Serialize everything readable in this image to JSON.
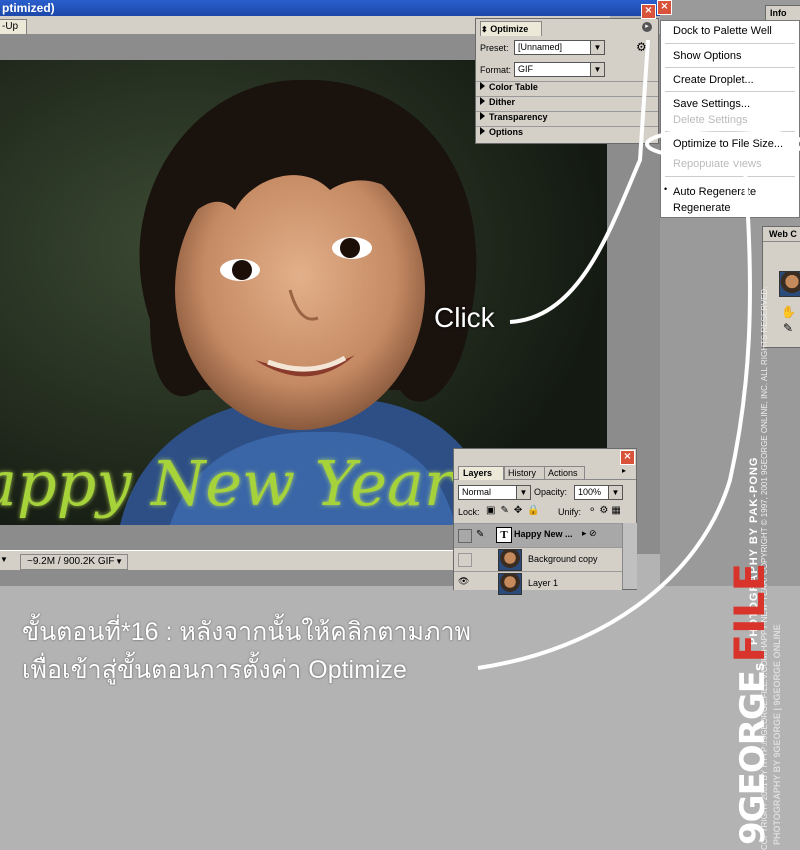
{
  "window": {
    "title": "ptimized)",
    "tab_label": "-Up"
  },
  "status_bar": {
    "file_size": "~9.2M / 900.2K GIF"
  },
  "artwork": {
    "text": "appy New Year"
  },
  "optimize_panel": {
    "tab_label": "Optimize",
    "preset_label": "Preset:",
    "preset_value": "[Unnamed]",
    "format_label": "Format:",
    "format_value": "GIF",
    "sections": [
      "Color Table",
      "Dither",
      "Transparency",
      "Options"
    ]
  },
  "info_tab": {
    "label": "Info"
  },
  "web_tab": {
    "label": "Web C"
  },
  "flyout_menu": {
    "items": [
      {
        "label": "Dock to Palette Well",
        "enabled": true
      },
      {
        "label": "Show Options",
        "enabled": true
      },
      {
        "label": "Create Droplet...",
        "enabled": true
      },
      {
        "label": "Save Settings...",
        "enabled": true
      },
      {
        "label": "Delete Settings",
        "enabled": false
      },
      {
        "label": "Optimize to File Size...",
        "enabled": true
      },
      {
        "label": "Repopulate Views",
        "enabled": false
      },
      {
        "label": "Auto Regenerate",
        "enabled": true,
        "checked": true
      },
      {
        "label": "Regenerate",
        "enabled": true
      }
    ]
  },
  "layers_panel": {
    "tabs": [
      "Layers",
      "History",
      "Actions"
    ],
    "blend_mode": "Normal",
    "opacity_label": "Opacity:",
    "opacity_value": "100%",
    "lock_label": "Lock:",
    "unify_label": "Unify:",
    "layers": [
      {
        "name": "Happy New ...",
        "type": "text",
        "selected": true
      },
      {
        "name": "Background copy",
        "type": "image",
        "selected": false
      },
      {
        "name": "Layer 1",
        "type": "image",
        "selected": false
      }
    ]
  },
  "annotation": {
    "click_label": "Click",
    "caption_line1": "ขั้นตอนที่*16 : หลังจากนั้นให้คลิกตามภาพ",
    "caption_line2": "เพื่อเข้าสู่ขั้นตอนการตั้งค่า Optimize"
  },
  "watermark": {
    "logo_text": "9GEORGE",
    "logo_sub": "FILE",
    "logo_suffix": "s",
    "credit1": "PHOTOGRAPHY BY PAK-PONG",
    "credit2": "PHOTOGRAPHY BY 9GEORGE | 9GEORGE ONLINE",
    "credit3": "COPYRIGHT 2001 BY HTTP://9GEORGE.FILE.V.COM/HAPPY-NEW-YEAR/  COPYRIGHT © 1997, 2001 9GEORGE ONLINE, INC. ALL RIGHTS RESERVED."
  },
  "colors": {
    "accent_green": "#a6d23a",
    "title_blue": "#2a5fce",
    "close_red": "#d9533a",
    "logo_red": "#d8342c"
  }
}
